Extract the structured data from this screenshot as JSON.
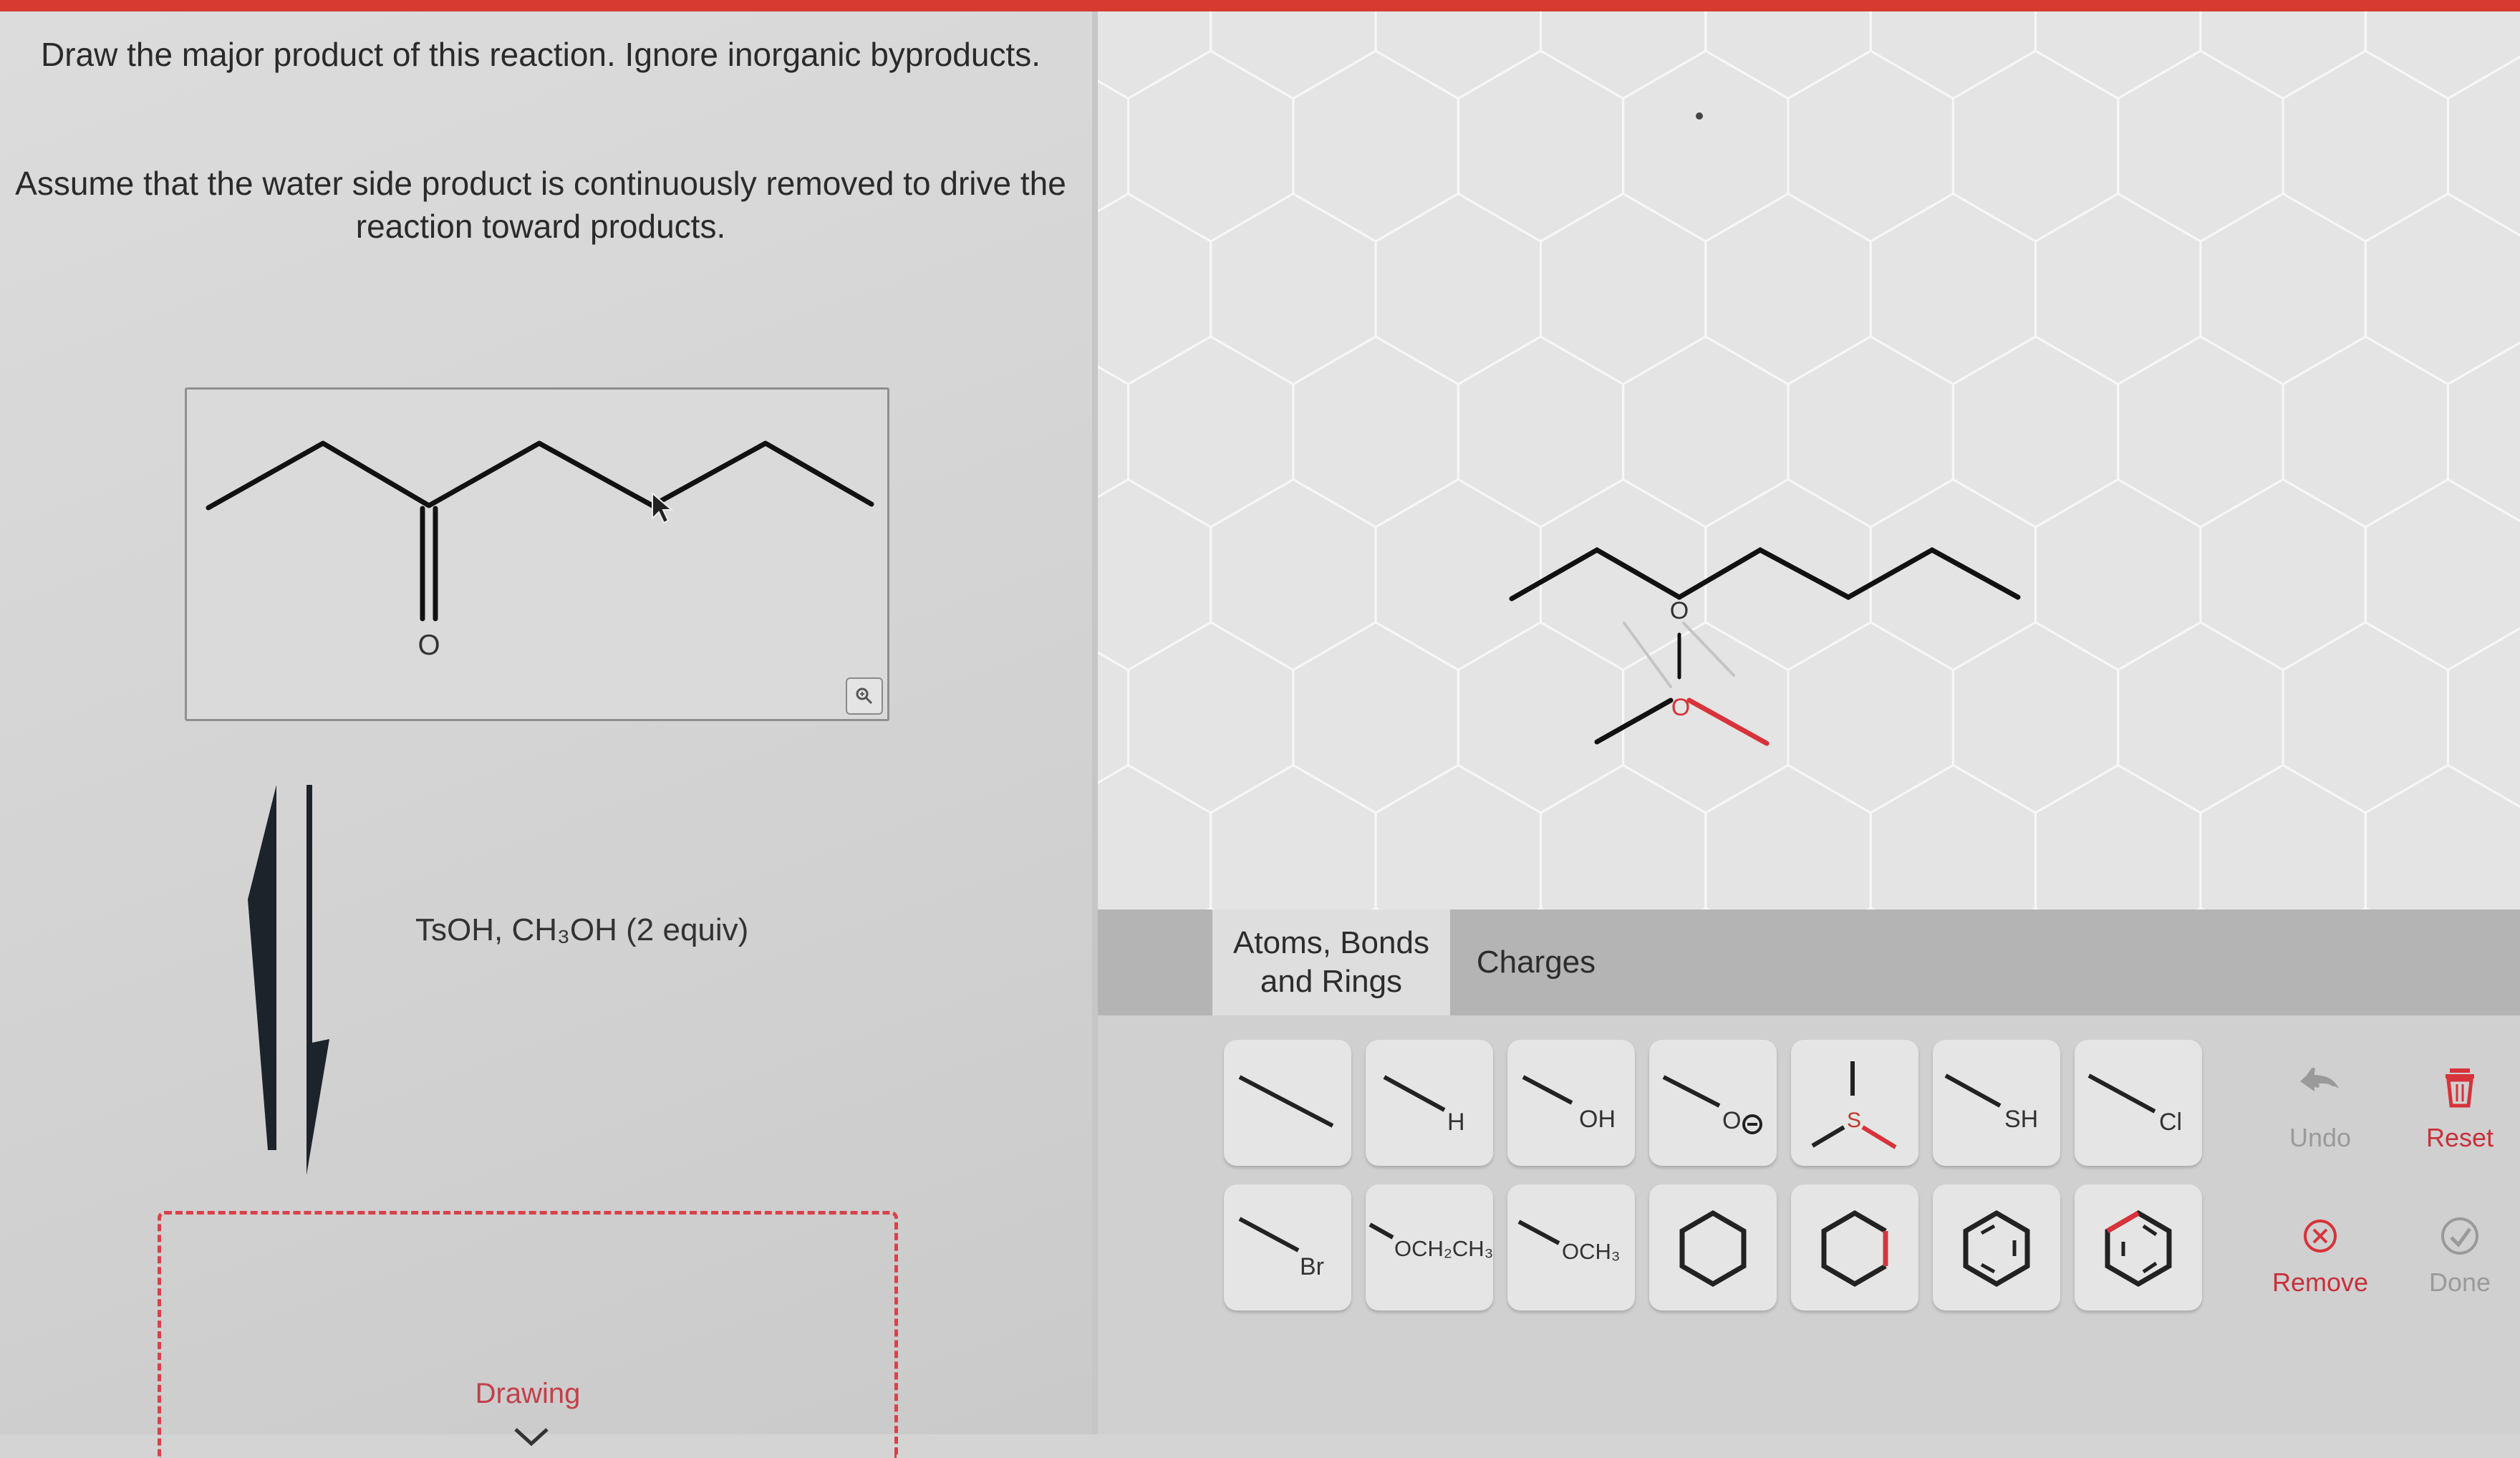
{
  "question": {
    "line1": "Draw the major product of this reaction. Ignore inorganic byproducts.",
    "line2": "Assume that the water side product is continuously removed to drive the reaction toward products."
  },
  "reactant": {
    "oxygen_label": "O"
  },
  "reagents": "TsOH, CH₃OH (2 equiv)",
  "drawing_area": {
    "label": "Drawing"
  },
  "canvas": {
    "oxygen_top": "O",
    "oxygen_bottom": "O"
  },
  "tabs": [
    {
      "label_line1": "Atoms, Bonds",
      "label_line2": "and Rings"
    },
    {
      "label": "Charges"
    }
  ],
  "tools": {
    "row1": [
      "H",
      "OH",
      "O",
      "S",
      "SH",
      "Cl"
    ],
    "row2": [
      "Br",
      "OCH₂CH₃",
      "OCH₃"
    ]
  },
  "actions": {
    "undo": "Undo",
    "reset": "Reset",
    "remove": "Remove",
    "done": "Done"
  },
  "colors": {
    "accent_red": "#d63a30",
    "action_red": "#c8303a",
    "disabled_gray": "#9a9a9a"
  }
}
